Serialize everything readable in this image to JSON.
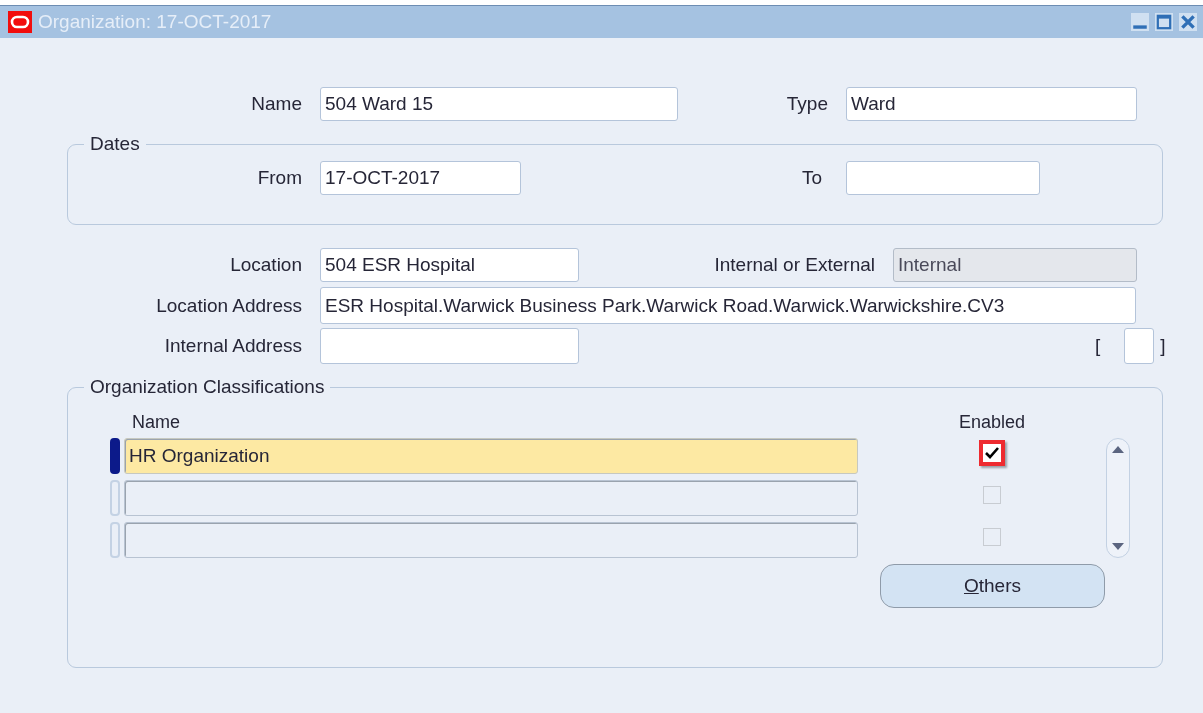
{
  "window": {
    "title": "Organization: 17-OCT-2017"
  },
  "name": {
    "label": "Name",
    "value": "504 Ward 15"
  },
  "type": {
    "label": "Type",
    "value": "Ward"
  },
  "dates": {
    "legend": "Dates",
    "from": {
      "label": "From",
      "value": "17-OCT-2017"
    },
    "to": {
      "label": "To"
    }
  },
  "location": {
    "label": "Location",
    "value": "504 ESR Hospital"
  },
  "internal_or_external": {
    "label": "Internal or External",
    "value": "Internal",
    "disabled": true
  },
  "location_address": {
    "label": "Location Address",
    "value": "ESR Hospital.Warwick Business Park.Warwick Road.Warwick.Warwickshire.CV3"
  },
  "internal_address": {
    "label": "Internal Address"
  },
  "bracket_field": {
    "open": "[",
    "close": "]"
  },
  "classifications": {
    "legend": "Organization Classifications",
    "columns": [
      "Name",
      "Enabled"
    ],
    "rows": [
      {
        "name": "HR Organization",
        "enabled": true,
        "selected": true,
        "disabled": false,
        "highlighted": true
      },
      {
        "enabled": false,
        "selected": false,
        "disabled": true,
        "highlighted": false
      },
      {
        "enabled": false,
        "selected": false,
        "disabled": true,
        "highlighted": false
      }
    ]
  },
  "others_button": {
    "label": "Others",
    "first_letter_underlined": true
  }
}
